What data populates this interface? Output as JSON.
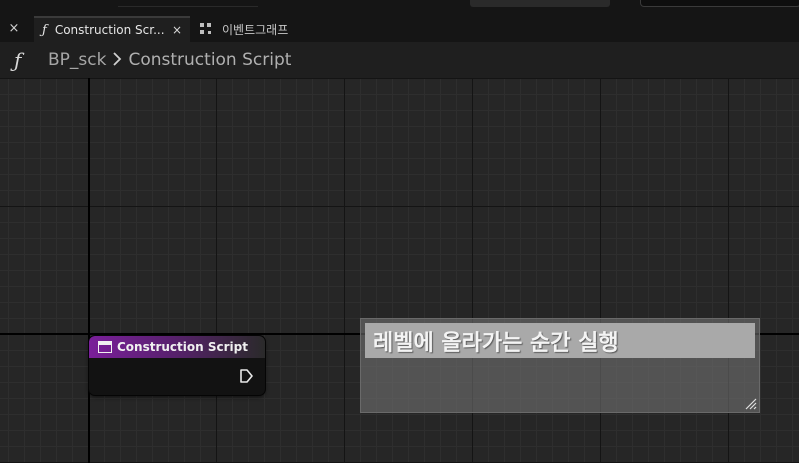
{
  "tabs": {
    "active": {
      "icon": "function-icon",
      "label": "Construction Scr...",
      "close": "×"
    },
    "inactive": {
      "icon": "event-graph-icon",
      "label": "이벤트그래프"
    },
    "prev_close": "×"
  },
  "breadcrumb": {
    "icon": "function-icon",
    "icon_glyph": "ƒ",
    "blueprint": "BP_sck",
    "separator": ">",
    "current": "Construction Script"
  },
  "graph": {
    "nodes": [
      {
        "title": "Construction Script",
        "header_color": "#7a1f9a",
        "pin": "exec-output-pin"
      }
    ],
    "comments": [
      {
        "text": "레벨에 올라가는 순간 실행"
      }
    ]
  },
  "colors": {
    "background": "#262626",
    "node_header": "#7a1f9a",
    "comment_title": "#a9a9a9"
  }
}
